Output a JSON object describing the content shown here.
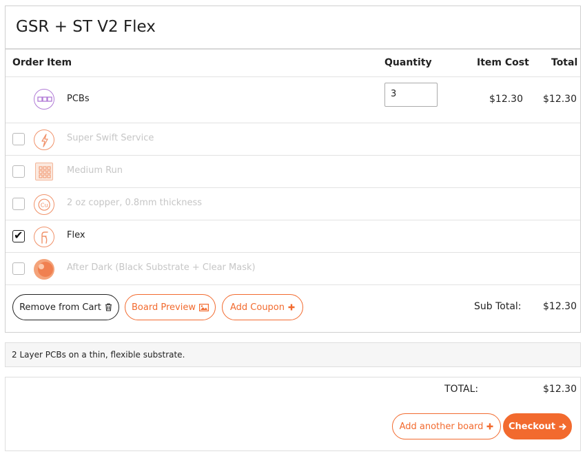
{
  "order": {
    "title": "GSR + ST V2 Flex",
    "headers": {
      "item": "Order Item",
      "quantity": "Quantity",
      "item_cost": "Item Cost",
      "total": "Total"
    },
    "pcbs": {
      "label": "PCBs",
      "quantity": "3",
      "item_cost": "$12.30",
      "total": "$12.30",
      "icon": "pcb-board-icon"
    },
    "options": [
      {
        "label": "Super Swift Service",
        "checked": false,
        "icon": "lightning-icon"
      },
      {
        "label": "Medium Run",
        "checked": false,
        "icon": "grid-panel-icon"
      },
      {
        "label": "2 oz copper, 0.8mm thickness",
        "checked": false,
        "icon": "copper-cu-icon"
      },
      {
        "label": "Flex",
        "checked": true,
        "icon": "flex-icon"
      },
      {
        "label": "After Dark (Black Substrate + Clear Mask)",
        "checked": false,
        "icon": "after-dark-icon"
      }
    ],
    "buttons": {
      "remove": "Remove from Cart",
      "preview": "Board Preview",
      "coupon": "Add Coupon"
    },
    "subtotal_label": "Sub Total:",
    "subtotal_value": "$12.30"
  },
  "description": "2 Layer PCBs on a thin, flexible substrate.",
  "summary": {
    "total_label": "TOTAL:",
    "total_value": "$12.30",
    "add_board": "Add another board",
    "checkout": "Checkout"
  },
  "colors": {
    "accent": "#f26a2e",
    "pcb_icon": "#b07ad6"
  }
}
